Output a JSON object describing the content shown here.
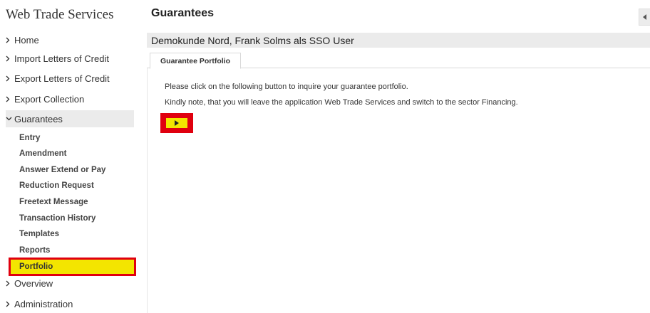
{
  "app": {
    "title": "Web Trade Services"
  },
  "page": {
    "title": "Guarantees"
  },
  "customer": {
    "label": "Demokunde Nord, Frank Solms als SSO User"
  },
  "sidebar": {
    "items": [
      {
        "label": "Home",
        "icon": "chevron-right-icon"
      },
      {
        "label": "Import Letters of Credit",
        "icon": "chevron-right-icon"
      },
      {
        "label": "Export Letters of Credit",
        "icon": "chevron-right-icon"
      },
      {
        "label": "Export Collection",
        "icon": "chevron-right-icon"
      },
      {
        "label": "Guarantees",
        "icon": "chevron-down-icon",
        "expanded": true
      },
      {
        "label": "Overview",
        "icon": "chevron-right-icon"
      },
      {
        "label": "Administration",
        "icon": "chevron-right-icon"
      }
    ],
    "sub_items": [
      {
        "label": "Entry"
      },
      {
        "label": "Amendment"
      },
      {
        "label": "Answer Extend or Pay"
      },
      {
        "label": "Reduction Request"
      },
      {
        "label": "Freetext Message"
      },
      {
        "label": "Transaction History"
      },
      {
        "label": "Templates"
      },
      {
        "label": "Reports"
      },
      {
        "label": "Portfolio",
        "selected": true
      }
    ]
  },
  "tabs": [
    {
      "label": "Guarantee Portfolio",
      "active": true
    }
  ],
  "content": {
    "line1": "Please click on the following button to inquire your guarantee portfolio.",
    "line2": "Kindly note, that you will leave the application Web Trade Services and switch to the sector Financing."
  },
  "colors": {
    "highlight_yellow": "#f3e500",
    "highlight_red": "#e0000f",
    "bar_grey": "#ebebeb"
  }
}
